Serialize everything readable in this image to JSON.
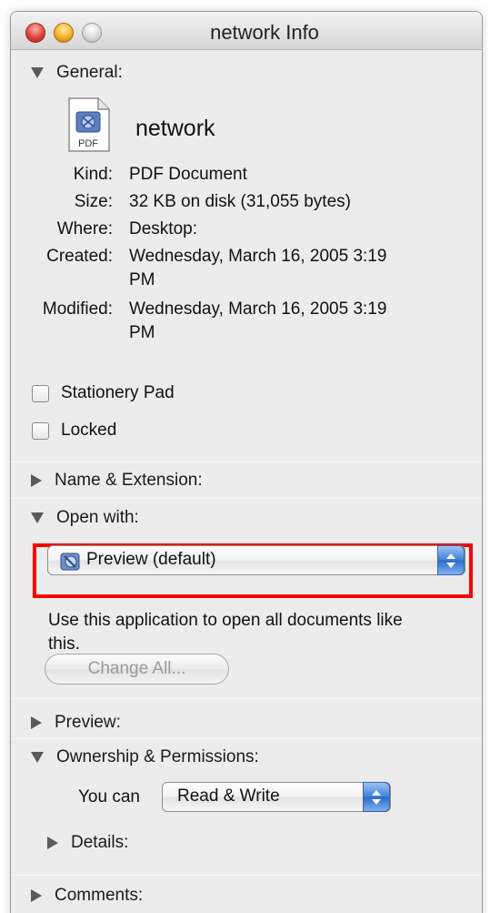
{
  "window": {
    "title": "network Info"
  },
  "general": {
    "header": "General:",
    "file_name": "network",
    "icon_badge": "PDF",
    "rows": [
      {
        "label": "Kind:",
        "value": "PDF Document"
      },
      {
        "label": "Size:",
        "value": "32 KB on disk (31,055 bytes)"
      },
      {
        "label": "Where:",
        "value": "Desktop:"
      },
      {
        "label": "Created:",
        "value_line1": "Wednesday, March 16, 2005 3:19",
        "value_line2": "PM"
      },
      {
        "label": "Modified:",
        "value_line1": "Wednesday, March 16, 2005 3:19",
        "value_line2": "PM"
      }
    ],
    "stationery_label": "Stationery Pad",
    "locked_label": "Locked"
  },
  "name_extension": {
    "header": "Name & Extension:"
  },
  "open_with": {
    "header": "Open with:",
    "selected_app": "Preview (default)",
    "description": "Use this application to open all documents like this.",
    "change_all_label": "Change All..."
  },
  "preview": {
    "header": "Preview:"
  },
  "ownership": {
    "header": "Ownership & Permissions:",
    "you_can_label": "You can",
    "permission_value": "Read & Write",
    "details_label": "Details:"
  },
  "comments": {
    "header": "Comments:"
  },
  "colors": {
    "highlight": "#ff0000",
    "arrow_blue": "#3d7fdc"
  },
  "icons": [
    "close-icon",
    "minimize-icon",
    "zoom-icon",
    "pdf-document-icon",
    "preview-app-icon",
    "disclosure-triangle-icon",
    "popup-arrows-icon"
  ]
}
